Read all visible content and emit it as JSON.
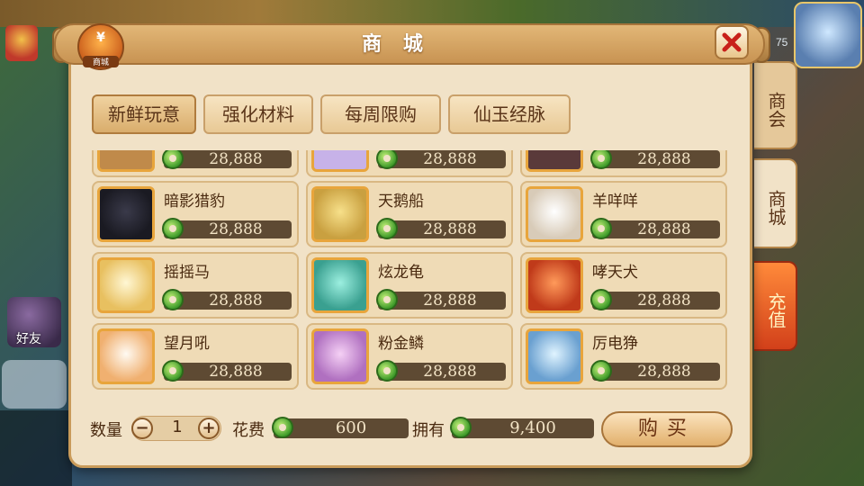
{
  "hud": {
    "level": "75",
    "friend_label": "好友"
  },
  "shop": {
    "title": "商 城",
    "icon_label": "商城",
    "icon_glyph": "¥",
    "close_icon": "close-x-icon"
  },
  "categories": [
    "新鲜玩意",
    "强化材料",
    "每周限购",
    "仙玉经脉"
  ],
  "items": [
    {
      "name": "",
      "price": "28,888",
      "color": "#c08a4a"
    },
    {
      "name": "",
      "price": "28,888",
      "color": "#c7b2e8"
    },
    {
      "name": "",
      "price": "28,888",
      "color": "#5a3a3a"
    },
    {
      "name": "暗影猎豹",
      "price": "28,888",
      "color": "#2a2a3a"
    },
    {
      "name": "天鹅船",
      "price": "28,888",
      "color": "#f2d87a"
    },
    {
      "name": "羊咩咩",
      "price": "28,888",
      "color": "#f4efe4"
    },
    {
      "name": "摇摇马",
      "price": "28,888",
      "color": "#f6e6a8"
    },
    {
      "name": "炫龙龟",
      "price": "28,888",
      "color": "#6ad0c0"
    },
    {
      "name": "哮天犬",
      "price": "28,888",
      "color": "#e0602a"
    },
    {
      "name": "望月吼",
      "price": "28,888",
      "color": "#f7e3cf"
    },
    {
      "name": "粉金鳞",
      "price": "28,888",
      "color": "#e0a6e6"
    },
    {
      "name": "厉电狰",
      "price": "28,888",
      "color": "#bfe4f6"
    }
  ],
  "footer": {
    "qty_label": "数量",
    "qty_minus": "−",
    "qty_value": "1",
    "qty_plus": "+",
    "cost_label": "花费",
    "cost_value": "600",
    "own_label": "拥有",
    "own_value": "9,400",
    "buy_label": "购买"
  },
  "side_tabs": {
    "market": "商会",
    "shop": "商城",
    "recharge": "充值"
  },
  "currency_icon": "jade-coin-icon"
}
